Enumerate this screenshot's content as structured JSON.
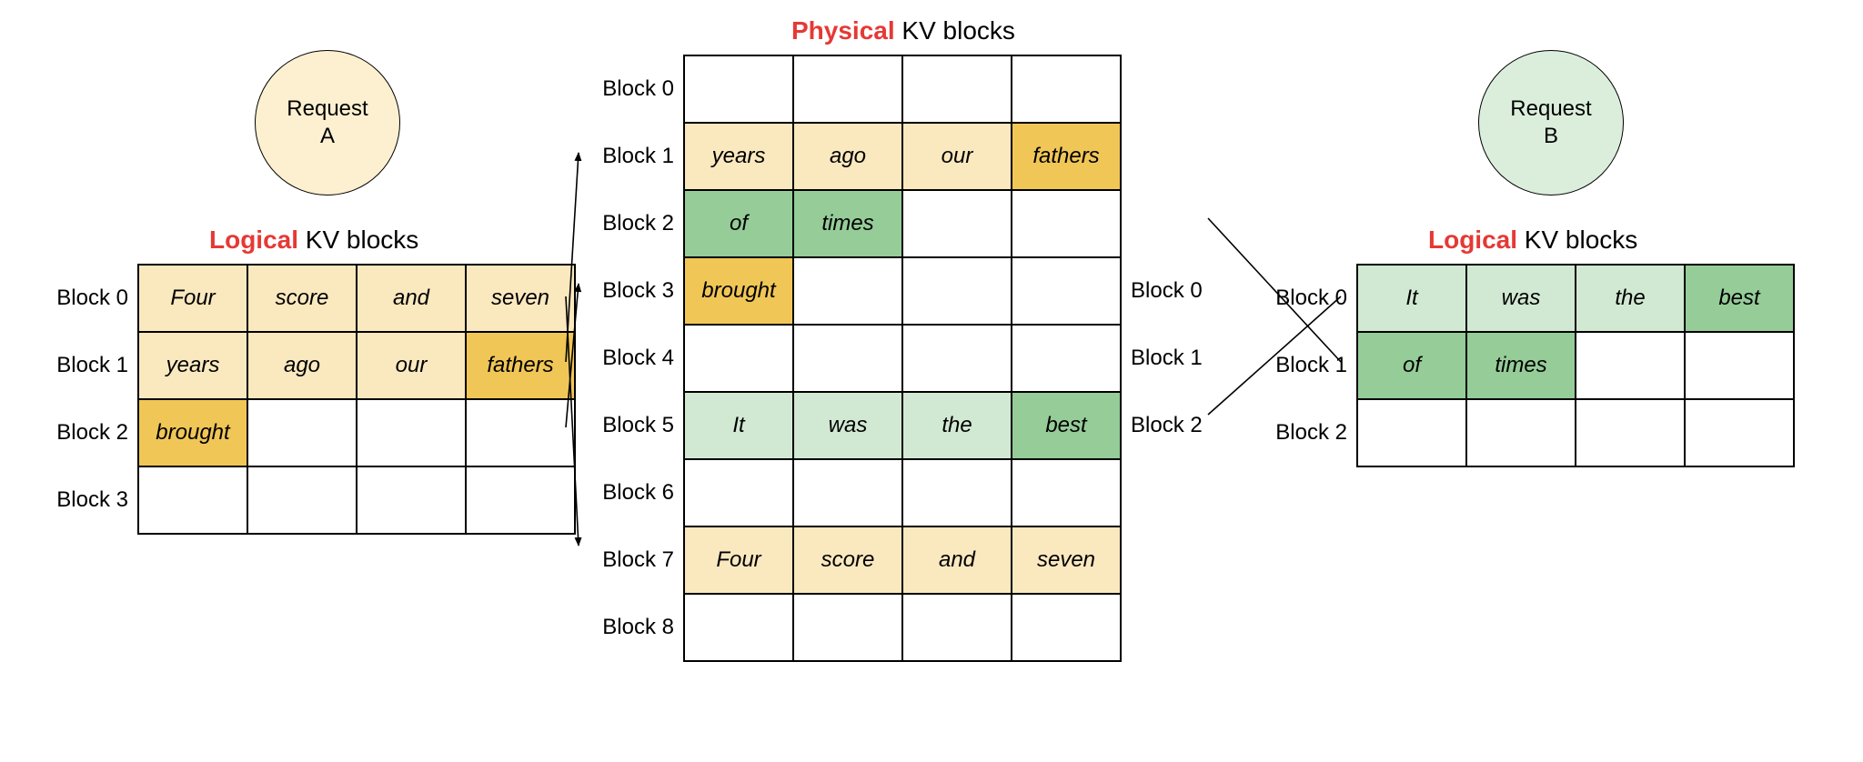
{
  "colors": {
    "red": "#e53935",
    "light_cream": "#fae8bf",
    "dark_cream": "#f0c657",
    "light_green": "#d1e9d2",
    "dark_green": "#95cc98",
    "circle_cream": "#fcf0d0",
    "circle_mint": "#dbeedc"
  },
  "requestA": {
    "label_line1": "Request",
    "label_line2": "A"
  },
  "requestB": {
    "label_line1": "Request",
    "label_line2": "B"
  },
  "headings": {
    "left": {
      "red": "Logical",
      "rest": " KV blocks"
    },
    "center": {
      "red": "Physical",
      "rest": " KV blocks"
    },
    "right": {
      "red": "Logical",
      "rest": " KV blocks"
    }
  },
  "tableA": {
    "rows": [
      {
        "label": "Block 0",
        "cells": [
          {
            "t": "Four",
            "bg": "lcream"
          },
          {
            "t": "score",
            "bg": "lcream"
          },
          {
            "t": "and",
            "bg": "lcream"
          },
          {
            "t": "seven",
            "bg": "lcream"
          }
        ]
      },
      {
        "label": "Block 1",
        "cells": [
          {
            "t": "years",
            "bg": "lcream"
          },
          {
            "t": "ago",
            "bg": "lcream"
          },
          {
            "t": "our",
            "bg": "lcream"
          },
          {
            "t": "fathers",
            "bg": "ocream"
          }
        ]
      },
      {
        "label": "Block 2",
        "cells": [
          {
            "t": "brought",
            "bg": "ocream"
          },
          {
            "t": "",
            "bg": "white"
          },
          {
            "t": "",
            "bg": "white"
          },
          {
            "t": "",
            "bg": "white"
          }
        ]
      },
      {
        "label": "Block 3",
        "cells": [
          {
            "t": "",
            "bg": "white"
          },
          {
            "t": "",
            "bg": "white"
          },
          {
            "t": "",
            "bg": "white"
          },
          {
            "t": "",
            "bg": "white"
          }
        ]
      }
    ]
  },
  "tableP": {
    "rows": [
      {
        "leftLabel": "Block 0",
        "rightLabel": "",
        "cells": [
          {
            "t": "",
            "bg": "white"
          },
          {
            "t": "",
            "bg": "white"
          },
          {
            "t": "",
            "bg": "white"
          },
          {
            "t": "",
            "bg": "white"
          }
        ]
      },
      {
        "leftLabel": "Block 1",
        "rightLabel": "",
        "cells": [
          {
            "t": "years",
            "bg": "lcream"
          },
          {
            "t": "ago",
            "bg": "lcream"
          },
          {
            "t": "our",
            "bg": "lcream"
          },
          {
            "t": "fathers",
            "bg": "ocream"
          }
        ]
      },
      {
        "leftLabel": "Block 2",
        "rightLabel": "",
        "cells": [
          {
            "t": "of",
            "bg": "mgreen"
          },
          {
            "t": "times",
            "bg": "mgreen"
          },
          {
            "t": "",
            "bg": "white"
          },
          {
            "t": "",
            "bg": "white"
          }
        ]
      },
      {
        "leftLabel": "Block 3",
        "rightLabel": "Block 0",
        "cells": [
          {
            "t": "brought",
            "bg": "ocream"
          },
          {
            "t": "",
            "bg": "white"
          },
          {
            "t": "",
            "bg": "white"
          },
          {
            "t": "",
            "bg": "white"
          }
        ]
      },
      {
        "leftLabel": "Block 4",
        "rightLabel": "Block 1",
        "cells": [
          {
            "t": "",
            "bg": "white"
          },
          {
            "t": "",
            "bg": "white"
          },
          {
            "t": "",
            "bg": "white"
          },
          {
            "t": "",
            "bg": "white"
          }
        ]
      },
      {
        "leftLabel": "Block 5",
        "rightLabel": "Block 2",
        "cells": [
          {
            "t": "It",
            "bg": "lgreen"
          },
          {
            "t": "was",
            "bg": "lgreen"
          },
          {
            "t": "the",
            "bg": "lgreen"
          },
          {
            "t": "best",
            "bg": "mgreen"
          }
        ]
      },
      {
        "leftLabel": "Block 6",
        "rightLabel": "",
        "cells": [
          {
            "t": "",
            "bg": "white"
          },
          {
            "t": "",
            "bg": "white"
          },
          {
            "t": "",
            "bg": "white"
          },
          {
            "t": "",
            "bg": "white"
          }
        ]
      },
      {
        "leftLabel": "Block 7",
        "rightLabel": "",
        "cells": [
          {
            "t": "Four",
            "bg": "lcream"
          },
          {
            "t": "score",
            "bg": "lcream"
          },
          {
            "t": "and",
            "bg": "lcream"
          },
          {
            "t": "seven",
            "bg": "lcream"
          }
        ]
      },
      {
        "leftLabel": "Block 8",
        "rightLabel": "",
        "cells": [
          {
            "t": "",
            "bg": "white"
          },
          {
            "t": "",
            "bg": "white"
          },
          {
            "t": "",
            "bg": "white"
          },
          {
            "t": "",
            "bg": "white"
          }
        ]
      }
    ]
  },
  "tableB": {
    "rows": [
      {
        "label": "Block 0",
        "cells": [
          {
            "t": "It",
            "bg": "lgreen"
          },
          {
            "t": "was",
            "bg": "lgreen"
          },
          {
            "t": "the",
            "bg": "lgreen"
          },
          {
            "t": "best",
            "bg": "mgreen"
          }
        ]
      },
      {
        "label": "Block 1",
        "cells": [
          {
            "t": "of",
            "bg": "mgreen"
          },
          {
            "t": "times",
            "bg": "mgreen"
          },
          {
            "t": "",
            "bg": "white"
          },
          {
            "t": "",
            "bg": "white"
          }
        ]
      },
      {
        "label": "Block 2",
        "cells": [
          {
            "t": "",
            "bg": "white"
          },
          {
            "t": "",
            "bg": "white"
          },
          {
            "t": "",
            "bg": "white"
          },
          {
            "t": "",
            "bg": "white"
          }
        ]
      }
    ]
  },
  "mappings": {
    "A_to_P": [
      {
        "fromRow": 0,
        "toRow": 7
      },
      {
        "fromRow": 1,
        "toRow": 1
      },
      {
        "fromRow": 2,
        "toRow": 3
      }
    ],
    "B_to_P": [
      {
        "fromRow": 0,
        "toRow": 5
      },
      {
        "fromRow": 1,
        "toRow": 2
      }
    ]
  }
}
